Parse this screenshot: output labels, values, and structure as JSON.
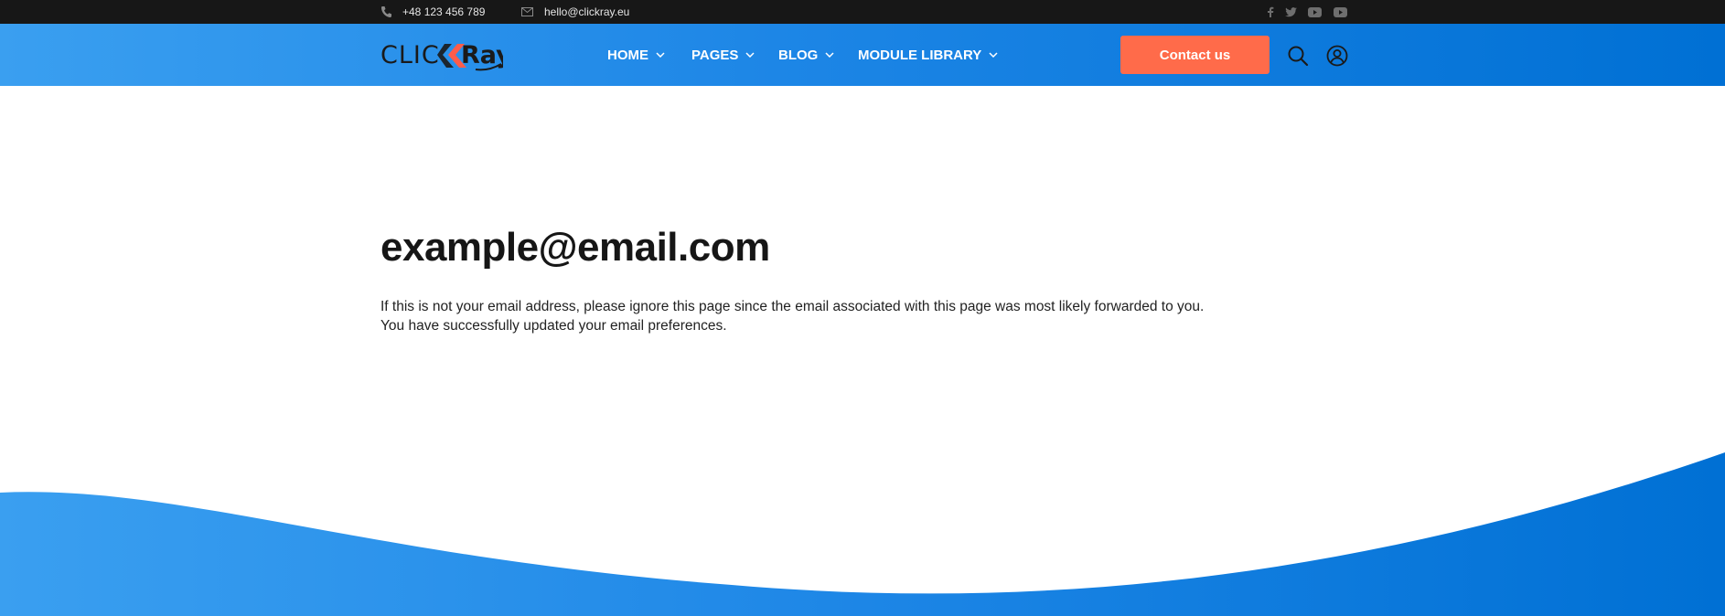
{
  "topbar": {
    "phone": "+48 123 456 789",
    "email": "hello@clickray.eu",
    "social_icons": [
      "facebook-icon",
      "twitter-icon",
      "youtube-icon",
      "youtube-icon"
    ]
  },
  "header": {
    "logo_text": "CLICKRay",
    "nav": [
      {
        "label": "HOME"
      },
      {
        "label": "PAGES"
      },
      {
        "label": "BLOG"
      },
      {
        "label": "MODULE LIBRARY"
      }
    ],
    "contact_label": "Contact us",
    "icons": [
      "search-icon",
      "user-icon"
    ]
  },
  "main": {
    "title": "example@email.com",
    "line1": "If this is not your email address, please ignore this page since the email associated with this page was most likely forwarded to you.",
    "line2": "You have successfully updated your email preferences."
  },
  "colors": {
    "header_start": "#3a9ff0",
    "header_end": "#0070d4",
    "accent": "#ff6b4a",
    "topbar": "#171717"
  }
}
